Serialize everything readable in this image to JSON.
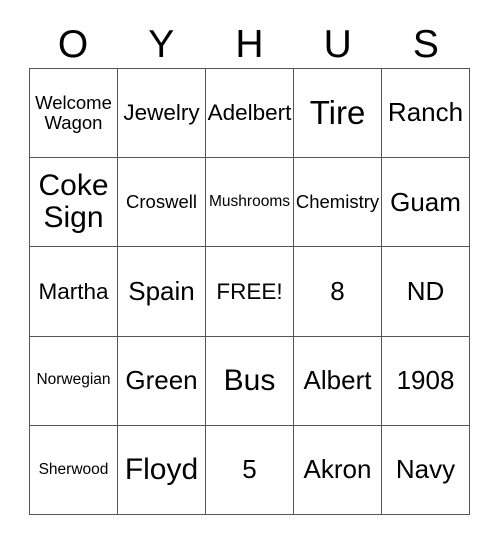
{
  "card": {
    "title_letters": [
      "O",
      "Y",
      "H",
      "U",
      "S"
    ],
    "rows": [
      [
        {
          "text": "Welcome\nWagon",
          "size": "fs-sm"
        },
        {
          "text": "Jewelry",
          "size": "fs-md"
        },
        {
          "text": "Adelbert",
          "size": "fs-md"
        },
        {
          "text": "Tire",
          "size": "fs-xxl"
        },
        {
          "text": "Ranch",
          "size": "fs-lg"
        }
      ],
      [
        {
          "text": "Coke\nSign",
          "size": "fs-xl"
        },
        {
          "text": "Croswell",
          "size": "fs-sm"
        },
        {
          "text": "Mushrooms",
          "size": "fs-xs"
        },
        {
          "text": "Chemistry",
          "size": "fs-sm"
        },
        {
          "text": "Guam",
          "size": "fs-lg"
        }
      ],
      [
        {
          "text": "Martha",
          "size": "fs-md"
        },
        {
          "text": "Spain",
          "size": "fs-lg"
        },
        {
          "text": "FREE!",
          "size": "fs-md"
        },
        {
          "text": "8",
          "size": "fs-lg"
        },
        {
          "text": "ND",
          "size": "fs-lg"
        }
      ],
      [
        {
          "text": "Norwegian",
          "size": "fs-xs"
        },
        {
          "text": "Green",
          "size": "fs-lg"
        },
        {
          "text": "Bus",
          "size": "fs-xl"
        },
        {
          "text": "Albert",
          "size": "fs-lg"
        },
        {
          "text": "1908",
          "size": "fs-lg"
        }
      ],
      [
        {
          "text": "Sherwood",
          "size": "fs-xs"
        },
        {
          "text": "Floyd",
          "size": "fs-xl"
        },
        {
          "text": "5",
          "size": "fs-lg"
        },
        {
          "text": "Akron",
          "size": "fs-lg"
        },
        {
          "text": "Navy",
          "size": "fs-lg"
        }
      ]
    ],
    "free_space": {
      "row": 2,
      "col": 2,
      "label": "FREE!"
    },
    "colors": {
      "background": "#ffffff",
      "text": "#000000",
      "grid_line": "#555555"
    }
  }
}
